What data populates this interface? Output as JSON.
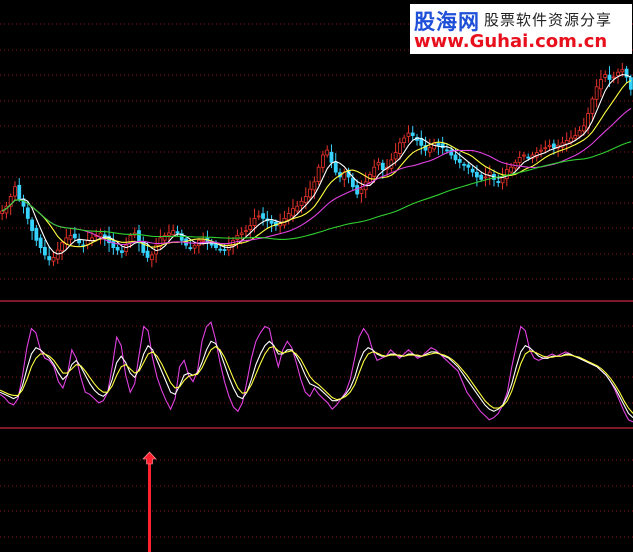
{
  "watermark": {
    "brand": "股海网",
    "tagline": "股票软件资源分享",
    "url": "www.Guhai.com.cn"
  },
  "colors": {
    "background": "#000000",
    "up_candle": "#e8332a",
    "down_candle": "#36d3ff",
    "ma_short": "#ffffff",
    "ma_mid": "#ffff40",
    "ma_long": "#e040e0",
    "ma_very_long": "#30d030",
    "divider": "#c8283c",
    "grid_dotted": "#8a1020",
    "signal_arrow": "#ff2030"
  },
  "chart_data": [
    {
      "type": "candlestick",
      "panel": "price",
      "title": "",
      "xlabel": "",
      "ylabel": "",
      "grid": "dotted-horizontal",
      "close": [
        70,
        72,
        76,
        80,
        75,
        72,
        67,
        62,
        58,
        55,
        52,
        50,
        51,
        54,
        57,
        59,
        60,
        59,
        57,
        56,
        58,
        59,
        60,
        61,
        59,
        57,
        55,
        54,
        53,
        56,
        60,
        61,
        57,
        53,
        51,
        52,
        56,
        59,
        60,
        61,
        62,
        61,
        58,
        56,
        55,
        56,
        58,
        58,
        57,
        56,
        55,
        54,
        54,
        56,
        58,
        60,
        61,
        62,
        64,
        67,
        68,
        67,
        66,
        65,
        64,
        65,
        67,
        69,
        71,
        72,
        74,
        76,
        79,
        82,
        88,
        93,
        95,
        90,
        86,
        84,
        86,
        84,
        80,
        77,
        79,
        82,
        85,
        88,
        90,
        87,
        88,
        91,
        94,
        98,
        100,
        102,
        101,
        99,
        97,
        95,
        96,
        98,
        97,
        96,
        95,
        93,
        91,
        90,
        89,
        88,
        86,
        84,
        83,
        84,
        86,
        83,
        82,
        84,
        87,
        88,
        90,
        92,
        93,
        92,
        93,
        94,
        95,
        96,
        97,
        96,
        97,
        98,
        99,
        100,
        101,
        103,
        105,
        110,
        116,
        121,
        124,
        126,
        124,
        125,
        127,
        128,
        125,
        120
      ],
      "ma_lines": [
        "ma_short",
        "ma_mid",
        "ma_long",
        "ma_very_long"
      ]
    },
    {
      "type": "line",
      "panel": "oscillator",
      "title": "",
      "xlabel": "",
      "ylabel": "",
      "ylim": [
        0,
        100
      ],
      "grid": "dotted-horizontal",
      "series": [
        {
          "color": "#e040e0",
          "values": [
            28,
            25,
            20,
            18,
            24,
            45,
            72,
            90,
            86,
            70,
            62,
            60,
            54,
            40,
            34,
            46,
            70,
            62,
            44,
            30,
            28,
            24,
            20,
            22,
            30,
            54,
            82,
            74,
            46,
            30,
            38,
            66,
            92,
            88,
            62,
            44,
            32,
            22,
            14,
            24,
            54,
            60,
            46,
            40,
            50,
            78,
            92,
            96,
            80,
            58,
            40,
            26,
            16,
            12,
            20,
            40,
            62,
            78,
            86,
            92,
            90,
            70,
            54,
            70,
            78,
            72,
            58,
            42,
            30,
            26,
            34,
            28,
            24,
            20,
            14,
            18,
            24,
            30,
            42,
            62,
            82,
            90,
            84,
            70,
            60,
            62,
            64,
            70,
            66,
            62,
            66,
            70,
            66,
            62,
            64,
            68,
            72,
            70,
            66,
            62,
            58,
            54,
            50,
            40,
            30,
            24,
            18,
            12,
            8,
            4,
            6,
            10,
            18,
            30,
            54,
            74,
            92,
            88,
            70,
            62,
            60,
            62,
            64,
            66,
            64,
            66,
            68,
            66,
            64,
            62,
            60,
            58,
            56,
            54,
            50,
            46,
            40,
            32,
            22,
            12,
            4,
            2
          ]
        },
        {
          "color": "#ffffff",
          "values": [
            30,
            28,
            26,
            24,
            26,
            36,
            52,
            66,
            72,
            70,
            66,
            62,
            56,
            48,
            42,
            46,
            56,
            60,
            54,
            46,
            38,
            32,
            28,
            26,
            30,
            42,
            58,
            64,
            58,
            48,
            44,
            52,
            66,
            74,
            70,
            60,
            50,
            40,
            30,
            28,
            36,
            46,
            48,
            46,
            48,
            58,
            70,
            78,
            76,
            68,
            56,
            44,
            34,
            26,
            24,
            30,
            42,
            56,
            66,
            74,
            78,
            74,
            66,
            66,
            70,
            70,
            64,
            56,
            46,
            38,
            36,
            34,
            30,
            26,
            22,
            22,
            24,
            28,
            34,
            44,
            58,
            68,
            72,
            70,
            66,
            64,
            64,
            66,
            66,
            64,
            64,
            66,
            66,
            64,
            64,
            66,
            68,
            68,
            66,
            64,
            62,
            58,
            54,
            48,
            42,
            36,
            30,
            24,
            18,
            14,
            12,
            14,
            18,
            26,
            38,
            54,
            68,
            74,
            72,
            68,
            64,
            62,
            62,
            64,
            64,
            64,
            66,
            66,
            64,
            62,
            60,
            58,
            56,
            54,
            50,
            46,
            40,
            34,
            26,
            18,
            10,
            6
          ]
        },
        {
          "color": "#ffff40",
          "values": [
            32,
            30,
            28,
            27,
            27,
            32,
            42,
            54,
            62,
            66,
            66,
            64,
            60,
            54,
            48,
            48,
            52,
            56,
            55,
            50,
            44,
            38,
            33,
            30,
            30,
            36,
            46,
            54,
            56,
            52,
            48,
            50,
            58,
            66,
            68,
            64,
            57,
            48,
            39,
            34,
            35,
            41,
            45,
            46,
            47,
            53,
            62,
            70,
            73,
            70,
            63,
            53,
            43,
            34,
            29,
            30,
            37,
            47,
            57,
            66,
            72,
            73,
            69,
            67,
            68,
            69,
            66,
            61,
            53,
            45,
            40,
            37,
            33,
            29,
            25,
            23,
            24,
            26,
            30,
            37,
            48,
            59,
            66,
            68,
            67,
            65,
            64,
            65,
            65,
            65,
            64,
            65,
            65,
            65,
            64,
            65,
            66,
            67,
            66,
            65,
            63,
            60,
            56,
            51,
            46,
            40,
            34,
            28,
            22,
            18,
            15,
            15,
            17,
            22,
            31,
            44,
            57,
            66,
            69,
            68,
            66,
            64,
            63,
            63,
            64,
            64,
            65,
            65,
            64,
            63,
            61,
            59,
            57,
            55,
            52,
            48,
            43,
            37,
            30,
            22,
            15,
            10
          ]
        }
      ]
    }
  ]
}
